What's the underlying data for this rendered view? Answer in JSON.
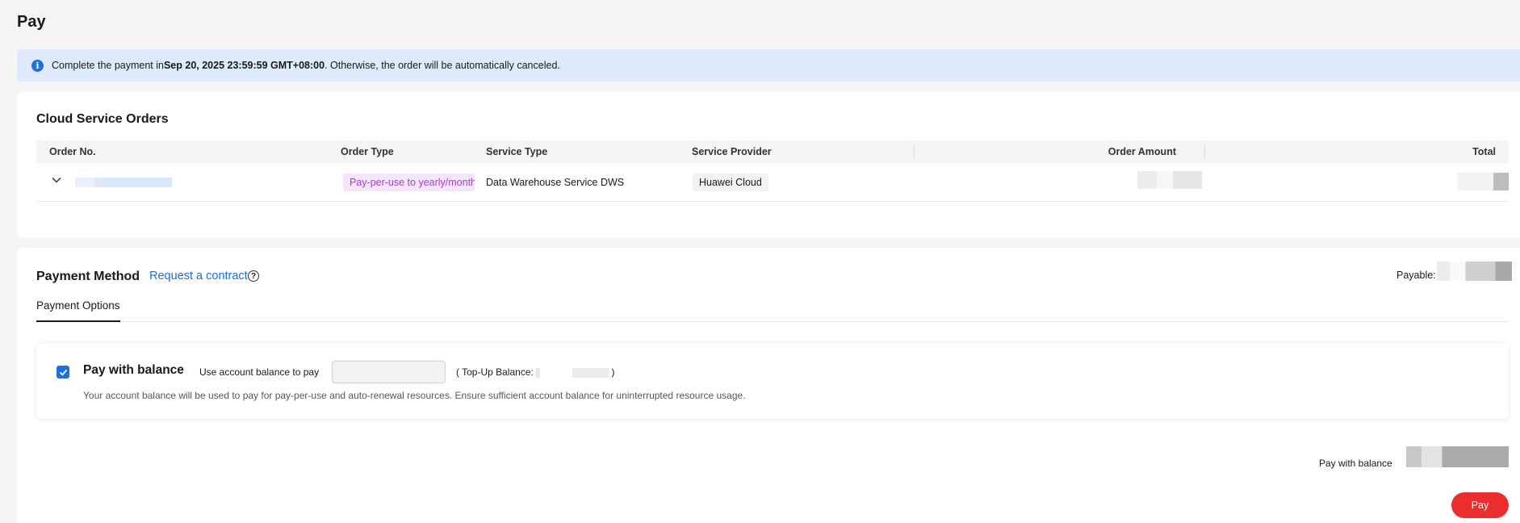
{
  "page": {
    "title": "Pay"
  },
  "notice": {
    "prefix": "Complete the payment in ",
    "deadline": "Sep 20, 2025 23:59:59 GMT+08:00",
    "suffix": ". Otherwise, the order will be automatically canceled."
  },
  "orders": {
    "title": "Cloud Service Orders",
    "columns": [
      "Order No.",
      "Order Type",
      "Service Type",
      "Service Provider",
      "Order Amount",
      "Total"
    ],
    "rows": [
      {
        "order_type": "Pay-per-use to yearly/monthly",
        "service_type": "Data Warehouse Service DWS",
        "service_provider": "Huawei Cloud"
      }
    ]
  },
  "payment": {
    "title": "Payment Method",
    "contract_link": "Request a contract",
    "payable_label": "Payable:",
    "tab": "Payment Options",
    "option": {
      "title": "Pay with balance",
      "use_text": "Use account balance to pay",
      "topup_open": "( Top-Up Balance:",
      "topup_close": ")",
      "description": "Your account balance will be used to pay for pay-per-use and auto-renewal resources. Ensure sufficient account balance for uninterrupted resource usage."
    },
    "summary_label": "Pay with balance",
    "pay_button": "Pay"
  },
  "colors": {
    "accent": "#1f6fe0",
    "pay_button": "#ea2d2d",
    "notice_bg": "#dfeafc",
    "tag_purple": "#a63ed1"
  },
  "icons": {
    "info": "info-icon",
    "chevron": "chevron-down-icon",
    "help": "question-circle-icon",
    "check": "check-icon"
  }
}
